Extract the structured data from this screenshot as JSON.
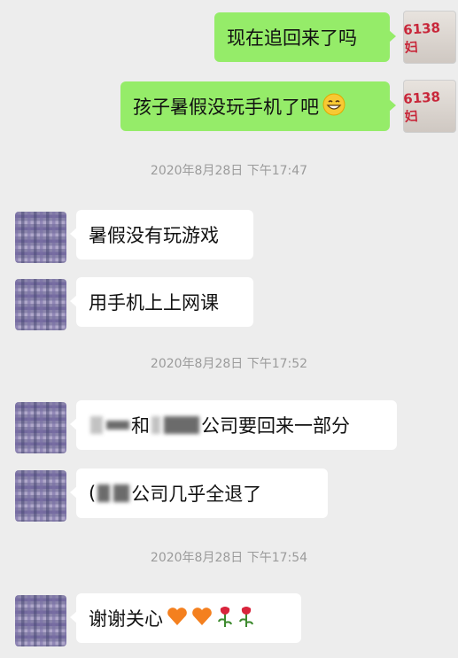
{
  "messages": [
    {
      "text": "现在追回来了吗"
    },
    {
      "text": "孩子暑假没玩手机了吧",
      "emoji": "grinning-face"
    },
    {
      "time": "2020年8月28日 下午17:47"
    },
    {
      "text": "暑假没有玩游戏"
    },
    {
      "text": "用手机上上网课"
    },
    {
      "time": "2020年8月28日 下午17:52"
    },
    {
      "text_a": "和",
      "text_b": "公司要回来一部分"
    },
    {
      "text_a": "(",
      "text_b": "公司几乎全退了"
    },
    {
      "time": "2020年8月28日 下午17:54"
    },
    {
      "text": "谢谢关心"
    }
  ],
  "sender_avatar_text": "6138 妇",
  "colors": {
    "background": "#ededed",
    "outgoing": "#95ec69",
    "incoming": "#ffffff",
    "timestamp": "#9b9b9b"
  },
  "icons": [
    "orange-heart-icon",
    "orange-heart-icon",
    "rose-icon",
    "rose-icon"
  ]
}
